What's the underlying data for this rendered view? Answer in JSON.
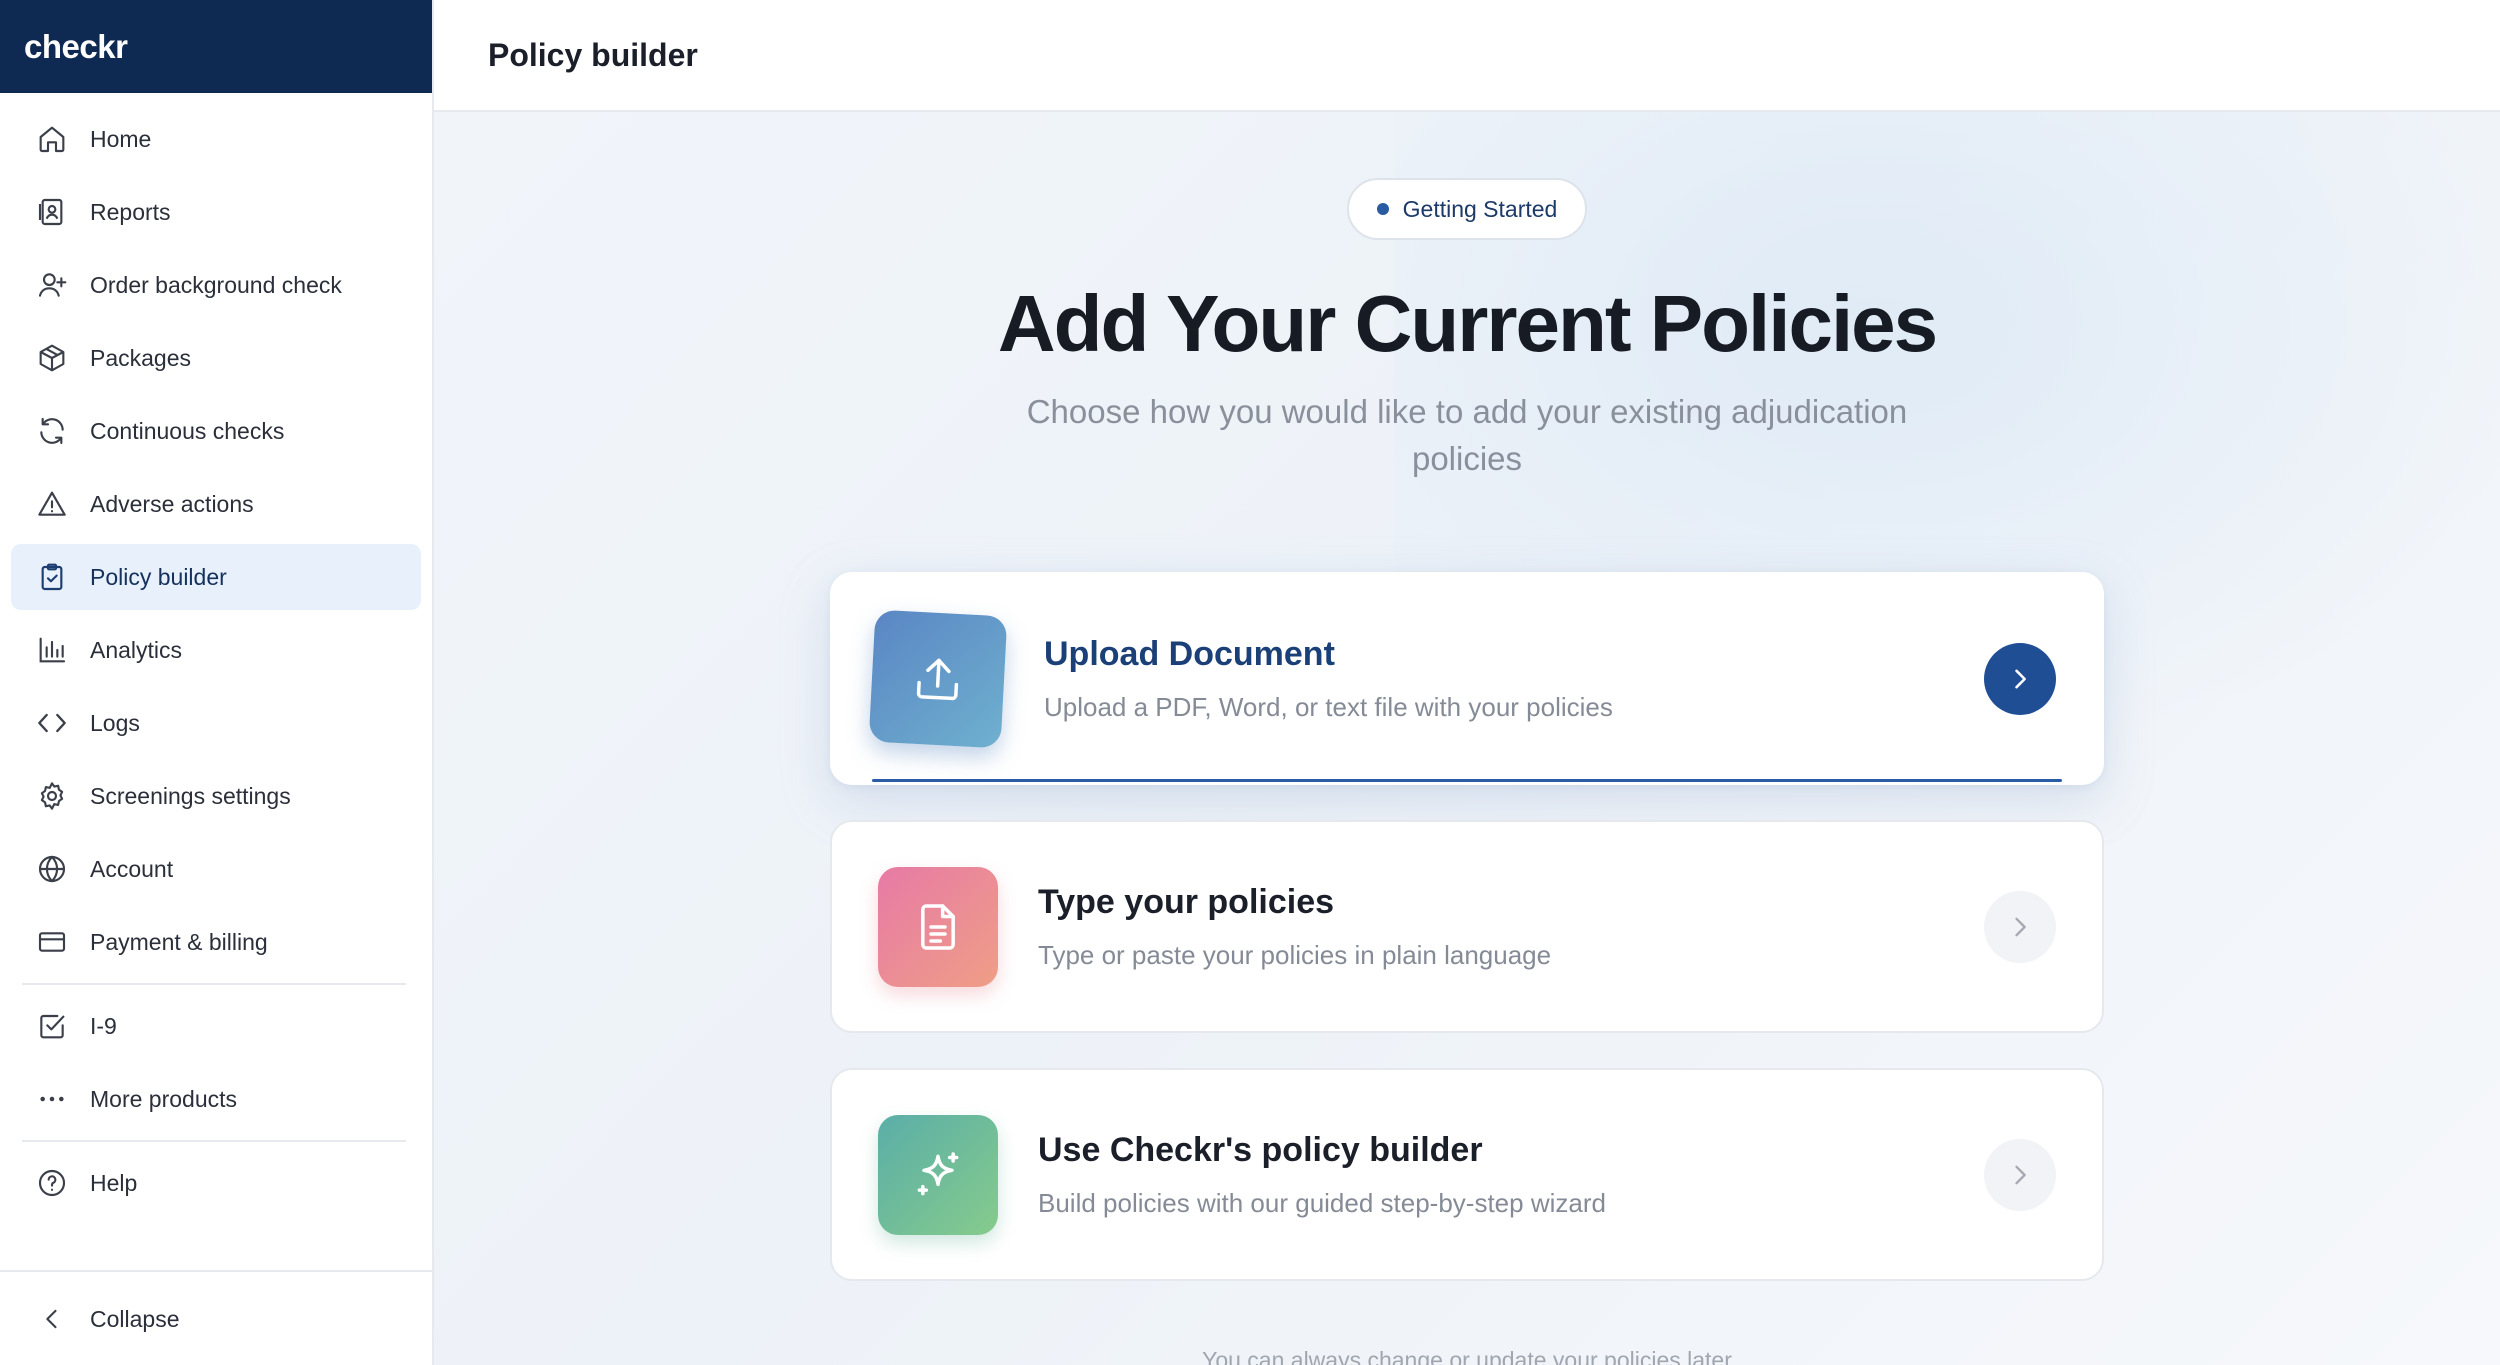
{
  "app": {
    "logo": "checkr"
  },
  "sidebar": {
    "items": [
      {
        "label": "Home",
        "icon": "home-icon"
      },
      {
        "label": "Reports",
        "icon": "reports-icon"
      },
      {
        "label": "Order background check",
        "icon": "user-plus-icon"
      },
      {
        "label": "Packages",
        "icon": "package-icon"
      },
      {
        "label": "Continuous checks",
        "icon": "refresh-icon"
      },
      {
        "label": "Adverse actions",
        "icon": "warning-icon"
      },
      {
        "label": "Policy builder",
        "icon": "clipboard-check-icon",
        "active": true
      },
      {
        "label": "Analytics",
        "icon": "bar-chart-icon"
      },
      {
        "label": "Logs",
        "icon": "code-icon"
      },
      {
        "label": "Screenings settings",
        "icon": "gear-icon"
      },
      {
        "label": "Account",
        "icon": "globe-icon"
      },
      {
        "label": "Payment & billing",
        "icon": "credit-card-icon"
      }
    ],
    "secondary": [
      {
        "label": "I-9",
        "icon": "checkbox-icon"
      },
      {
        "label": "More products",
        "icon": "more-icon"
      }
    ],
    "help": {
      "label": "Help",
      "icon": "help-icon"
    },
    "collapse": {
      "label": "Collapse",
      "icon": "chevron-left-icon"
    }
  },
  "header": {
    "title": "Policy builder"
  },
  "main": {
    "badge": "Getting Started",
    "title": "Add Your Current Policies",
    "subtitle": "Choose how you would like to add your existing adjudication policies",
    "options": [
      {
        "title": "Upload Document",
        "description": "Upload a PDF, Word, or text file with your policies",
        "icon": "upload-icon",
        "selected": true
      },
      {
        "title": "Type your policies",
        "description": "Type or paste your policies in plain language",
        "icon": "document-icon",
        "selected": false
      },
      {
        "title": "Use Checkr's policy builder",
        "description": "Build policies with our guided step-by-step wizard",
        "icon": "sparkle-icon",
        "selected": false
      }
    ],
    "footer_note": "You can always change or update your policies later"
  },
  "colors": {
    "brand_navy": "#0f2a52",
    "accent_blue": "#1f4e95",
    "active_nav_bg": "#e7f0fb"
  }
}
